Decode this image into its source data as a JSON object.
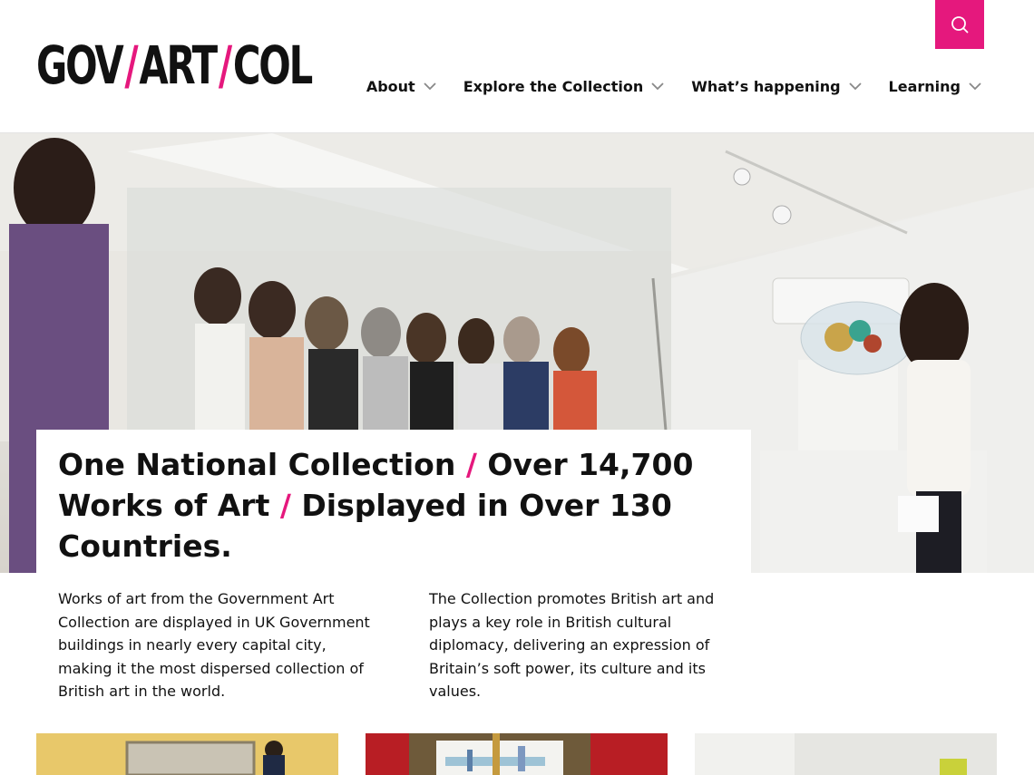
{
  "logo": {
    "part1": "GOV",
    "slash": "/",
    "part2": "ART",
    "part3": "COL"
  },
  "nav": {
    "items": [
      {
        "label": "About"
      },
      {
        "label": "Explore the Collection"
      },
      {
        "label": "What’s happening"
      },
      {
        "label": "Learning"
      }
    ]
  },
  "search": {
    "icon": "search-icon"
  },
  "hero": {
    "headline_1": "One National Collection ",
    "separator": "/",
    "headline_2": " Over 14,700 Works of Art ",
    "headline_3": " Displayed in Over 130 Countries."
  },
  "intro": {
    "left": "Works of art from the Government Art Collection are displayed in UK Government buildings in nearly every capital city, making it the most dispersed collection of British art in the world.",
    "right": "The Collection promotes British art and plays a key role in British cultural diplomacy, delivering an expression of Britain’s soft power, its culture and its values."
  },
  "colors": {
    "accent": "#e5187d",
    "text": "#111111"
  }
}
